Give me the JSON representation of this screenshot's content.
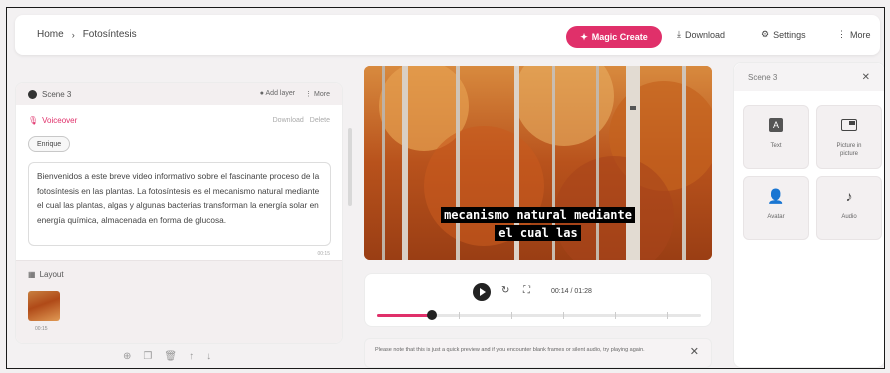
{
  "header": {
    "breadcrumb": [
      "Home",
      "Fotosíntesis"
    ],
    "breadcrumb_sep": "›",
    "magic_create": "Magic Create",
    "download": "Download",
    "settings": "Settings",
    "more": "More",
    "accent": "#e0306a"
  },
  "scene": {
    "title": "Scene 3",
    "add_layer": "Add layer",
    "more": "More",
    "voiceover_label": "Voiceover",
    "download": "Download",
    "delete": "Delete",
    "speaker": "Enrique",
    "script": "Bienvenidos a este breve video informativo sobre el fascinante proceso de la fotosíntesis en las plantas. La fotosíntesis es el mecanismo natural mediante el cual las plantas, algas y algunas bacterias transforman la energía solar en energía química, almacenada en forma de glucosa.",
    "script_duration": "00:15",
    "layout_label": "Layout",
    "thumb_time": "00:15"
  },
  "toolbar": {
    "icons": [
      "add-circle-icon",
      "copy-icon",
      "trash-icon",
      "arrow-up-icon",
      "arrow-down-icon"
    ]
  },
  "video": {
    "caption_line1": "mecanismo natural mediante",
    "caption_line2": "el cual las"
  },
  "player": {
    "timecode": "00:14 / 01:28",
    "progress": 0.17
  },
  "notice": {
    "text": "Please note that this is just a quick preview and if you encounter blank frames or silent audio, try playing again."
  },
  "right_panel": {
    "title": "Scene 3",
    "tiles": [
      {
        "label": "Text",
        "icon": "text-icon"
      },
      {
        "label": "Picture in picture",
        "icon": "picture-in-picture-icon"
      },
      {
        "label": "Avatar",
        "icon": "avatar-icon"
      },
      {
        "label": "Audio",
        "icon": "audio-icon"
      }
    ]
  }
}
